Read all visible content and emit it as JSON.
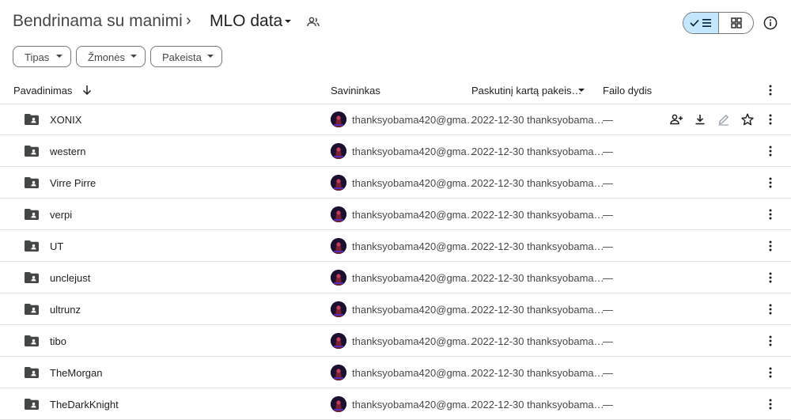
{
  "breadcrumb": {
    "root": "Bendrinama su manimi",
    "separator": "›",
    "current": "MLO data"
  },
  "filters": [
    {
      "label": "Tipas"
    },
    {
      "label": "Žmonės"
    },
    {
      "label": "Pakeista"
    }
  ],
  "columns": {
    "name": "Pavadinimas",
    "owner": "Savininkas",
    "modified": "Paskutinį kartą pakeis…",
    "size": "Failo dydis"
  },
  "rows": [
    {
      "name": "XONIX",
      "owner": "thanksyobama420@gma…",
      "modified": "2022-12-30 thanksyobama…",
      "size": "—"
    },
    {
      "name": "western",
      "owner": "thanksyobama420@gma…",
      "modified": "2022-12-30 thanksyobama…",
      "size": "—"
    },
    {
      "name": "Virre Pirre",
      "owner": "thanksyobama420@gma…",
      "modified": "2022-12-30 thanksyobama…",
      "size": "—"
    },
    {
      "name": "verpi",
      "owner": "thanksyobama420@gma…",
      "modified": "2022-12-30 thanksyobama…",
      "size": "—"
    },
    {
      "name": "UT",
      "owner": "thanksyobama420@gma…",
      "modified": "2022-12-30 thanksyobama…",
      "size": "—"
    },
    {
      "name": "unclejust",
      "owner": "thanksyobama420@gma…",
      "modified": "2022-12-30 thanksyobama…",
      "size": "—"
    },
    {
      "name": "ultrunz",
      "owner": "thanksyobama420@gma…",
      "modified": "2022-12-30 thanksyobama…",
      "size": "—"
    },
    {
      "name": "tibo",
      "owner": "thanksyobama420@gma…",
      "modified": "2022-12-30 thanksyobama…",
      "size": "—"
    },
    {
      "name": "TheMorgan",
      "owner": "thanksyobama420@gma…",
      "modified": "2022-12-30 thanksyobama…",
      "size": "—"
    },
    {
      "name": "TheDarkKnight",
      "owner": "thanksyobama420@gma…",
      "modified": "2022-12-30 thanksyobama…",
      "size": "—"
    }
  ],
  "hover_row_actions": [
    "add-person-icon",
    "download-icon",
    "edit-icon",
    "star-icon"
  ],
  "view_mode": "list",
  "colors": {
    "accent": "#c2e7ff",
    "icon": "#444746",
    "divider": "#e0e0e0",
    "avatar_bg": "#1b1030"
  }
}
